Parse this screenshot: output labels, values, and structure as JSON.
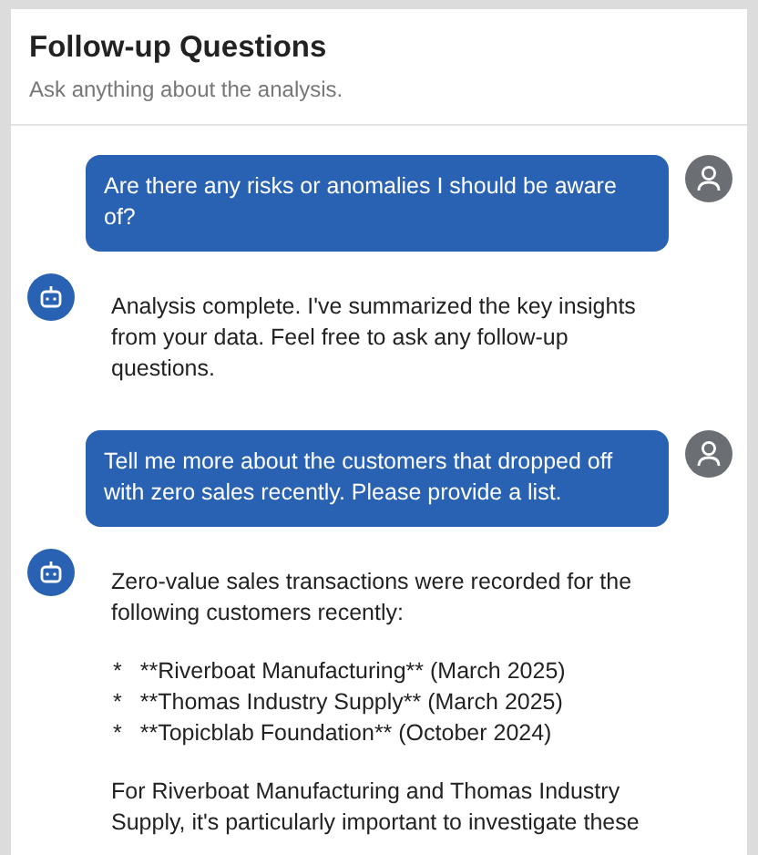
{
  "header": {
    "title": "Follow-up Questions",
    "subtitle": "Ask anything about the analysis."
  },
  "messages": [
    {
      "kind": "user",
      "text": "Are there any risks or anomalies I should be aware of?"
    },
    {
      "kind": "bot",
      "blocks": [
        {
          "kind": "paragraph",
          "text": "Analysis complete. I've summarized the key insights from your data. Feel free to ask any follow-up questions."
        }
      ]
    },
    {
      "kind": "user",
      "text": "Tell me more about the customers that dropped off with zero sales recently. Please provide a list."
    },
    {
      "kind": "bot",
      "blocks": [
        {
          "kind": "paragraph",
          "text": "Zero-value sales transactions were recorded for the following customers recently:"
        },
        {
          "kind": "list",
          "items": [
            {
              "bullet": "*",
              "text": "**Riverboat Manufacturing** (March 2025)"
            },
            {
              "bullet": "*",
              "text": "**Thomas Industry Supply** (March 2025)"
            },
            {
              "bullet": "*",
              "text": "**Topicblab Foundation** (October 2024)"
            }
          ]
        },
        {
          "kind": "paragraph",
          "text": "For Riverboat Manufacturing and Thomas Industry Supply, it's particularly important to investigate these"
        }
      ]
    }
  ]
}
